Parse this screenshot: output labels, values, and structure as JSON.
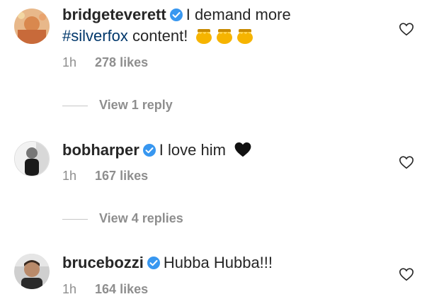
{
  "comments": [
    {
      "username": "bridgeteverett",
      "text_before": "I demand more",
      "hashtag": "#silverfox",
      "text_after": "content!",
      "emoji": "honey-pot-emoji x3",
      "time": "1h",
      "likes": "278 likes",
      "replies": "View 1 reply"
    },
    {
      "username": "bobharper",
      "text": "I love him",
      "emoji": "black-heart-emoji",
      "time": "1h",
      "likes": "167 likes",
      "replies": "View 4 replies"
    },
    {
      "username": "brucebozzi",
      "text": "Hubba Hubba!!!",
      "time": "1h",
      "likes": "164 likes"
    }
  ],
  "colors": {
    "verified": "#3897f0",
    "hashtag": "#00376b",
    "meta": "#8e8e8e"
  }
}
